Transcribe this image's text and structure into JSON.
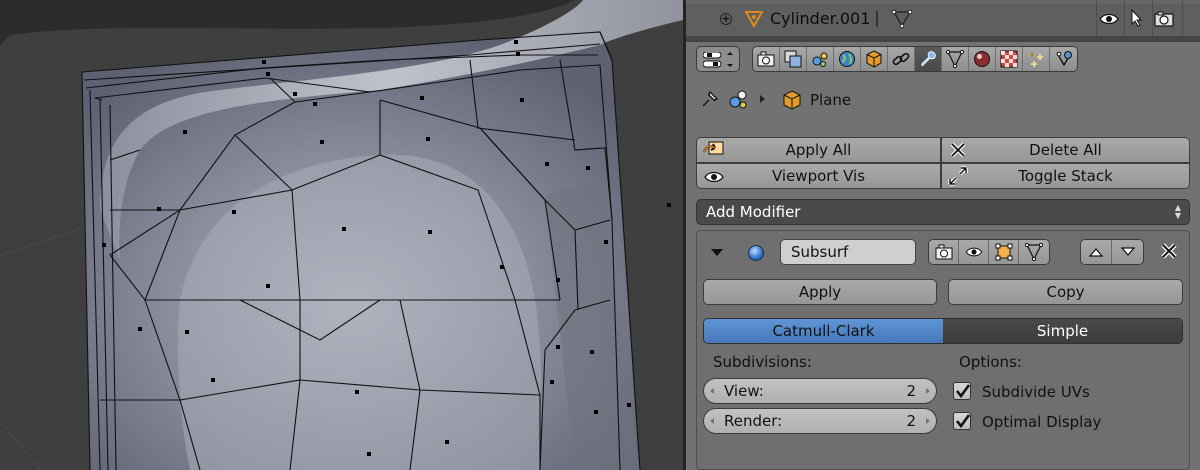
{
  "outliner": {
    "object_name": "Cylinder.001"
  },
  "breadcrumb": {
    "object": "Plane"
  },
  "tool_buttons": {
    "apply_all": "Apply All",
    "delete_all": "Delete All",
    "viewport_vis": "Viewport Vis",
    "toggle_stack": "Toggle Stack"
  },
  "add_modifier": {
    "label": "Add Modifier"
  },
  "modifier": {
    "name": "Subsurf",
    "apply_label": "Apply",
    "copy_label": "Copy",
    "algorithm_options": [
      "Catmull-Clark",
      "Simple"
    ],
    "selected_algorithm": "Catmull-Clark",
    "subdivisions_label": "Subdivisions:",
    "view_label": "View:",
    "view_value": "2",
    "render_label": "Render:",
    "render_value": "2",
    "options_label": "Options:",
    "subdivide_uvs_label": "Subdivide UVs",
    "subdivide_uvs_checked": true,
    "optimal_display_label": "Optimal Display",
    "optimal_display_checked": true
  },
  "colors": {
    "accent": "#5a8fd0",
    "panel_bg": "#727272",
    "viewport_bg": "#3f3f3f"
  }
}
